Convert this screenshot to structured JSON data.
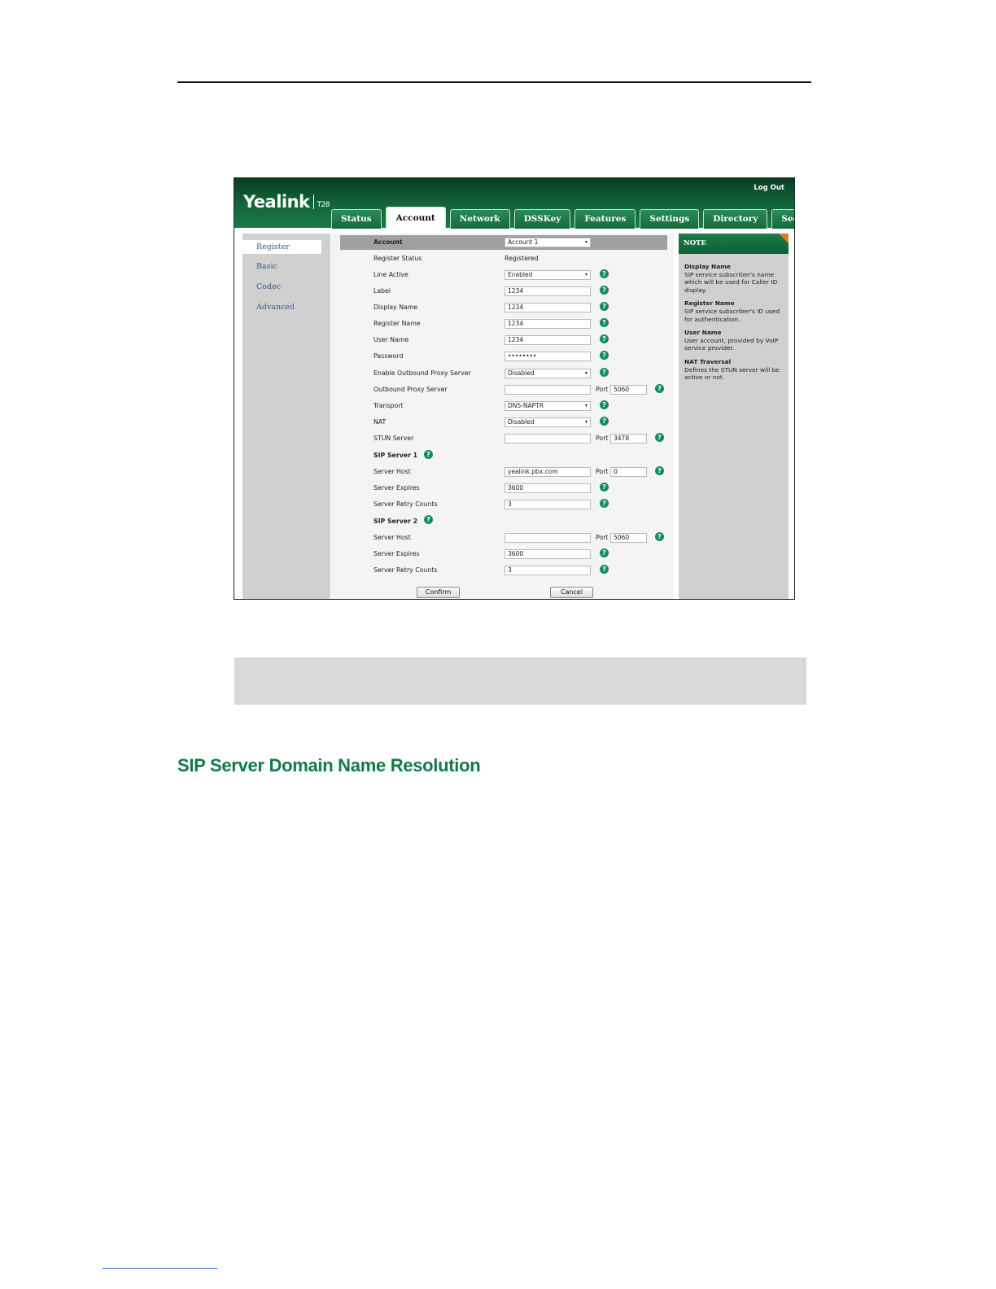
{
  "header": {
    "brand": "Yealink",
    "model": "T28",
    "logout": "Log Out"
  },
  "tabs": [
    {
      "label": "Status"
    },
    {
      "label": "Account"
    },
    {
      "label": "Network"
    },
    {
      "label": "DSSKey"
    },
    {
      "label": "Features"
    },
    {
      "label": "Settings"
    },
    {
      "label": "Directory"
    },
    {
      "label": "Security"
    }
  ],
  "nav": [
    {
      "label": "Register"
    },
    {
      "label": "Basic"
    },
    {
      "label": "Codec"
    },
    {
      "label": "Advanced"
    }
  ],
  "form": {
    "account_label": "Account",
    "account_value": "Account 1",
    "register_status_label": "Register Status",
    "register_status_value": "Registered",
    "line_active_label": "Line Active",
    "line_active_value": "Enabled",
    "label_label": "Label",
    "label_value": "1234",
    "display_name_label": "Display Name",
    "display_name_value": "1234",
    "register_name_label": "Register Name",
    "register_name_value": "1234",
    "user_name_label": "User Name",
    "user_name_value": "1234",
    "password_label": "Password",
    "password_value": "••••••••",
    "outbound_enable_label": "Enable Outbound Proxy Server",
    "outbound_enable_value": "Disabled",
    "outbound_server_label": "Outbound Proxy Server",
    "outbound_server_value": "",
    "outbound_port_value": "5060",
    "transport_label": "Transport",
    "transport_value": "DNS-NAPTR",
    "nat_label": "NAT",
    "nat_value": "Disabled",
    "stun_label": "STUN Server",
    "stun_value": "",
    "stun_port_value": "3478",
    "port_label": "Port",
    "sip1_title": "SIP Server 1",
    "sip1_host_label": "Server Host",
    "sip1_host_value": "yealink.pbx.com",
    "sip1_port_value": "0",
    "sip1_expires_label": "Server Expires",
    "sip1_expires_value": "3600",
    "sip1_retry_label": "Server Retry Counts",
    "sip1_retry_value": "3",
    "sip2_title": "SIP Server 2",
    "sip2_host_label": "Server Host",
    "sip2_host_value": "",
    "sip2_port_value": "5060",
    "sip2_expires_label": "Server Expires",
    "sip2_expires_value": "3600",
    "sip2_retry_label": "Server Retry Counts",
    "sip2_retry_value": "3",
    "confirm_label": "Confirm",
    "cancel_label": "Cancel",
    "help_glyph": "?",
    "dropdown_glyph": "▾"
  },
  "note": {
    "title": "NOTE",
    "items": [
      {
        "term": "Display Name",
        "desc": "SIP service subscriber's name which will be used for Caller ID display."
      },
      {
        "term": "Register Name",
        "desc": "SIP service subscriber's ID used for authentication."
      },
      {
        "term": "User Name",
        "desc": "User account, provided by VoIP service provider."
      },
      {
        "term": "NAT Traversal",
        "desc": "Defines the STUN server will be active or not."
      }
    ]
  },
  "section_heading": "SIP Server Domain Name Resolution",
  "colors": {
    "brand_green": "#13663b",
    "heading_green": "#117a4a",
    "help_teal": "#128a6a",
    "note_corner": "#e8781e"
  }
}
